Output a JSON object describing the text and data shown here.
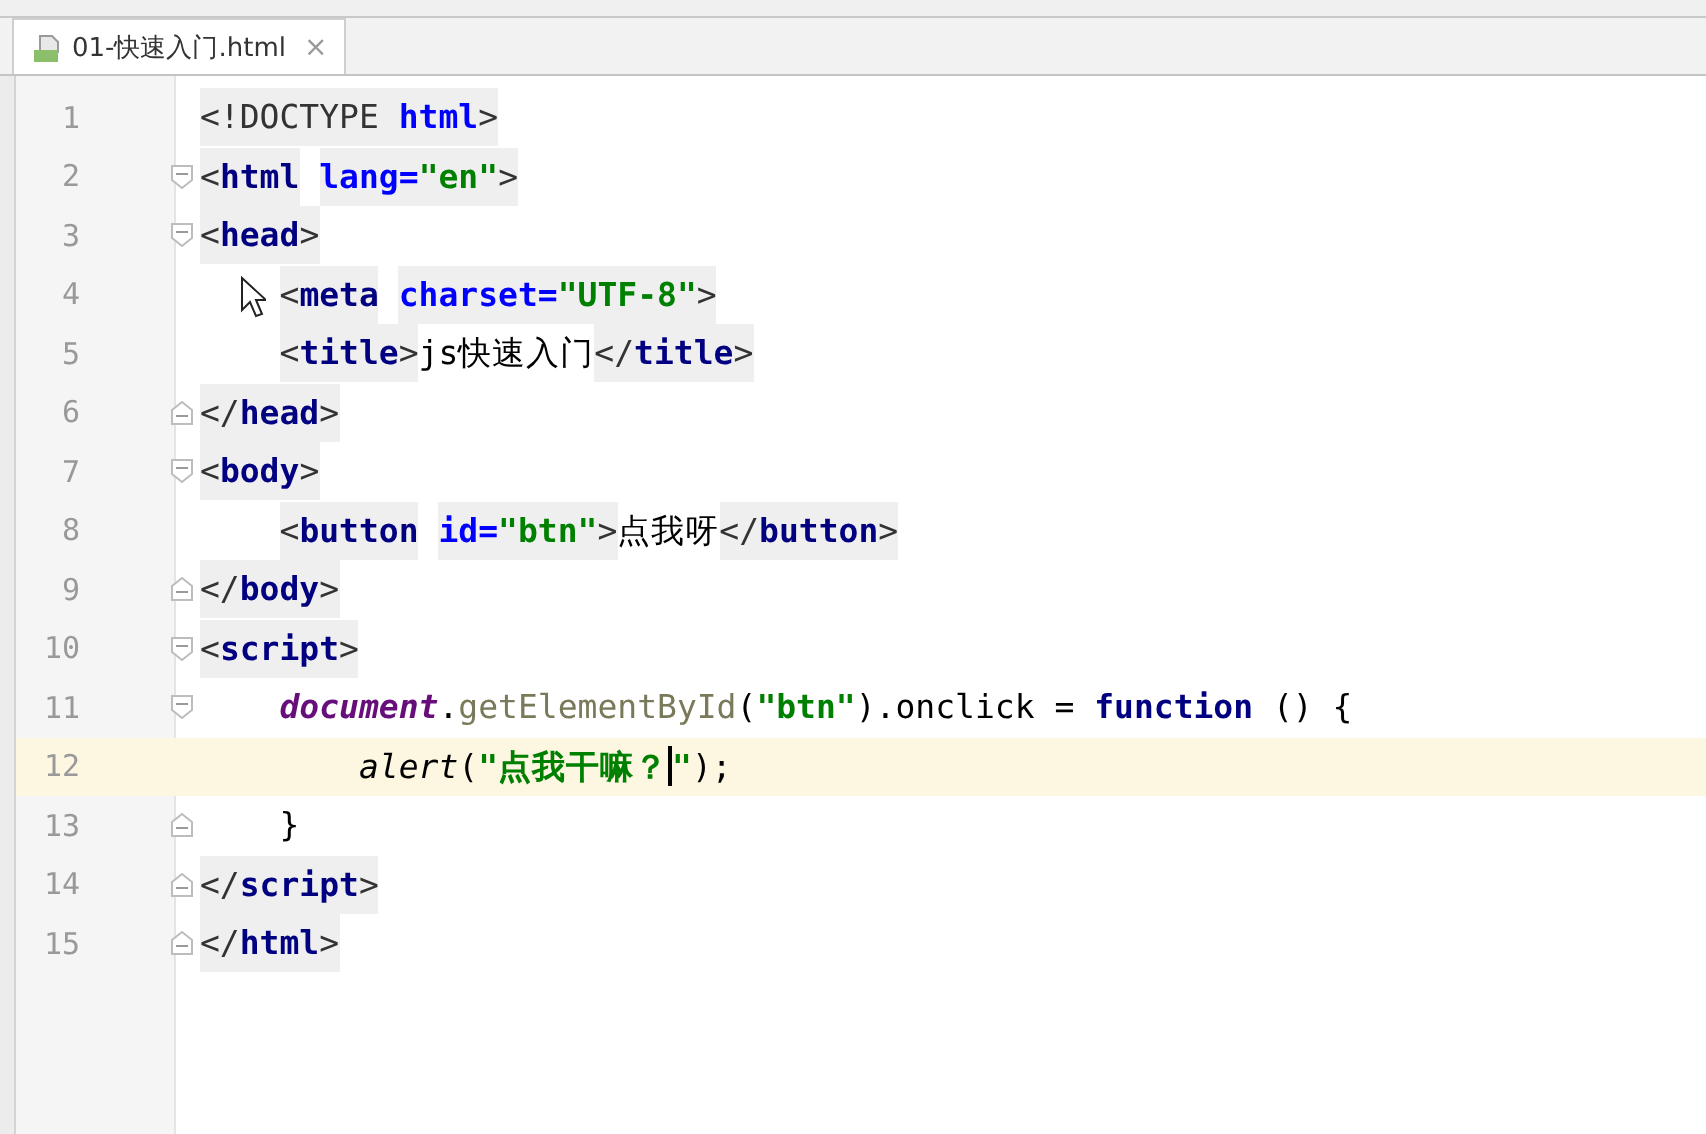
{
  "tabs": [
    {
      "label": "01-快速入门.html",
      "selected": true,
      "close": "×"
    }
  ],
  "lines": [
    {
      "number": "1",
      "fold_start": false,
      "fold_end": false,
      "current": false,
      "tokens": [
        {
          "text": "<!DOCTYPE ",
          "kind": "bracket"
        },
        {
          "text": "html",
          "kind": "attr"
        },
        {
          "text": ">",
          "kind": "bracket"
        }
      ]
    },
    {
      "number": "2",
      "fold_start": true,
      "fold_end": false,
      "current": false,
      "tokens": [
        {
          "text": "<",
          "kind": "bracket"
        },
        {
          "text": "html",
          "kind": "tag"
        },
        {
          "text": " lang",
          "kind": "attr"
        },
        {
          "text": "=",
          "kind": "attr"
        },
        {
          "text": "\"en\"",
          "kind": "value"
        },
        {
          "text": ">",
          "kind": "bracket"
        }
      ]
    },
    {
      "number": "3",
      "fold_start": true,
      "fold_end": false,
      "current": false,
      "tokens": [
        {
          "text": "<",
          "kind": "bracket"
        },
        {
          "text": "head",
          "kind": "tag"
        },
        {
          "text": ">",
          "kind": "bracket"
        }
      ]
    },
    {
      "number": "4",
      "fold_start": false,
      "fold_end": false,
      "current": false,
      "pointer": true,
      "tokens": [
        {
          "text": "    <",
          "kind": "bracket"
        },
        {
          "text": "meta",
          "kind": "tag"
        },
        {
          "text": " charset",
          "kind": "attr"
        },
        {
          "text": "=",
          "kind": "attr"
        },
        {
          "text": "\"UTF-8\"",
          "kind": "value"
        },
        {
          "text": ">",
          "kind": "bracket"
        }
      ]
    },
    {
      "number": "5",
      "fold_start": false,
      "fold_end": false,
      "current": false,
      "tokens": [
        {
          "text": "    <",
          "kind": "bracket"
        },
        {
          "text": "title",
          "kind": "tag"
        },
        {
          "text": ">",
          "kind": "bracket"
        },
        {
          "text": "js快速入门",
          "kind": "text"
        },
        {
          "text": "</",
          "kind": "bracket"
        },
        {
          "text": "title",
          "kind": "tag"
        },
        {
          "text": ">",
          "kind": "bracket"
        }
      ]
    },
    {
      "number": "6",
      "fold_start": false,
      "fold_end": true,
      "current": false,
      "tokens": [
        {
          "text": "</",
          "kind": "bracket"
        },
        {
          "text": "head",
          "kind": "tag"
        },
        {
          "text": ">",
          "kind": "bracket"
        }
      ]
    },
    {
      "number": "7",
      "fold_start": true,
      "fold_end": false,
      "current": false,
      "tokens": [
        {
          "text": "<",
          "kind": "bracket"
        },
        {
          "text": "body",
          "kind": "tag"
        },
        {
          "text": ">",
          "kind": "bracket"
        }
      ]
    },
    {
      "number": "8",
      "fold_start": false,
      "fold_end": false,
      "current": false,
      "tokens": [
        {
          "text": "    <",
          "kind": "bracket"
        },
        {
          "text": "button",
          "kind": "tag"
        },
        {
          "text": " id",
          "kind": "attr"
        },
        {
          "text": "=",
          "kind": "attr"
        },
        {
          "text": "\"btn\"",
          "kind": "value"
        },
        {
          "text": ">",
          "kind": "bracket"
        },
        {
          "text": "点我呀",
          "kind": "text"
        },
        {
          "text": "</",
          "kind": "bracket"
        },
        {
          "text": "button",
          "kind": "tag"
        },
        {
          "text": ">",
          "kind": "bracket"
        }
      ]
    },
    {
      "number": "9",
      "fold_start": false,
      "fold_end": true,
      "current": false,
      "tokens": [
        {
          "text": "</",
          "kind": "bracket"
        },
        {
          "text": "body",
          "kind": "tag"
        },
        {
          "text": ">",
          "kind": "bracket"
        }
      ]
    },
    {
      "number": "10",
      "fold_start": true,
      "fold_end": false,
      "current": false,
      "tokens": [
        {
          "text": "<",
          "kind": "bracket"
        },
        {
          "text": "script",
          "kind": "tag"
        },
        {
          "text": ">",
          "kind": "bracket"
        }
      ]
    },
    {
      "number": "11",
      "fold_start": true,
      "fold_end": false,
      "current": false,
      "tokens": [
        {
          "text": "    document",
          "kind": "object"
        },
        {
          "text": ".",
          "kind": "plain"
        },
        {
          "text": "getElementById",
          "kind": "method"
        },
        {
          "text": "(",
          "kind": "plain"
        },
        {
          "text": "\"btn\"",
          "kind": "string"
        },
        {
          "text": ").onclick = ",
          "kind": "plain"
        },
        {
          "text": "function",
          "kind": "keyword"
        },
        {
          "text": " () {",
          "kind": "plain"
        }
      ]
    },
    {
      "number": "12",
      "fold_start": false,
      "fold_end": false,
      "current": true,
      "tokens": [
        {
          "text": "        alert",
          "kind": "call"
        },
        {
          "text": "(",
          "kind": "plain"
        },
        {
          "text": "\"点我干嘛？",
          "kind": "string"
        },
        {
          "text": "\"",
          "kind": "string",
          "caret_before": true
        },
        {
          "text": ");",
          "kind": "plain"
        }
      ]
    },
    {
      "number": "13",
      "fold_start": false,
      "fold_end": true,
      "current": false,
      "tokens": [
        {
          "text": "    }",
          "kind": "plain"
        }
      ]
    },
    {
      "number": "14",
      "fold_start": false,
      "fold_end": true,
      "current": false,
      "tokens": [
        {
          "text": "</",
          "kind": "bracket"
        },
        {
          "text": "script",
          "kind": "tag"
        },
        {
          "text": ">",
          "kind": "bracket"
        }
      ]
    },
    {
      "number": "15",
      "fold_start": false,
      "fold_end": true,
      "current": false,
      "tokens": [
        {
          "text": "</",
          "kind": "bracket"
        },
        {
          "text": "html",
          "kind": "tag"
        },
        {
          "text": ">",
          "kind": "bracket"
        }
      ]
    }
  ]
}
